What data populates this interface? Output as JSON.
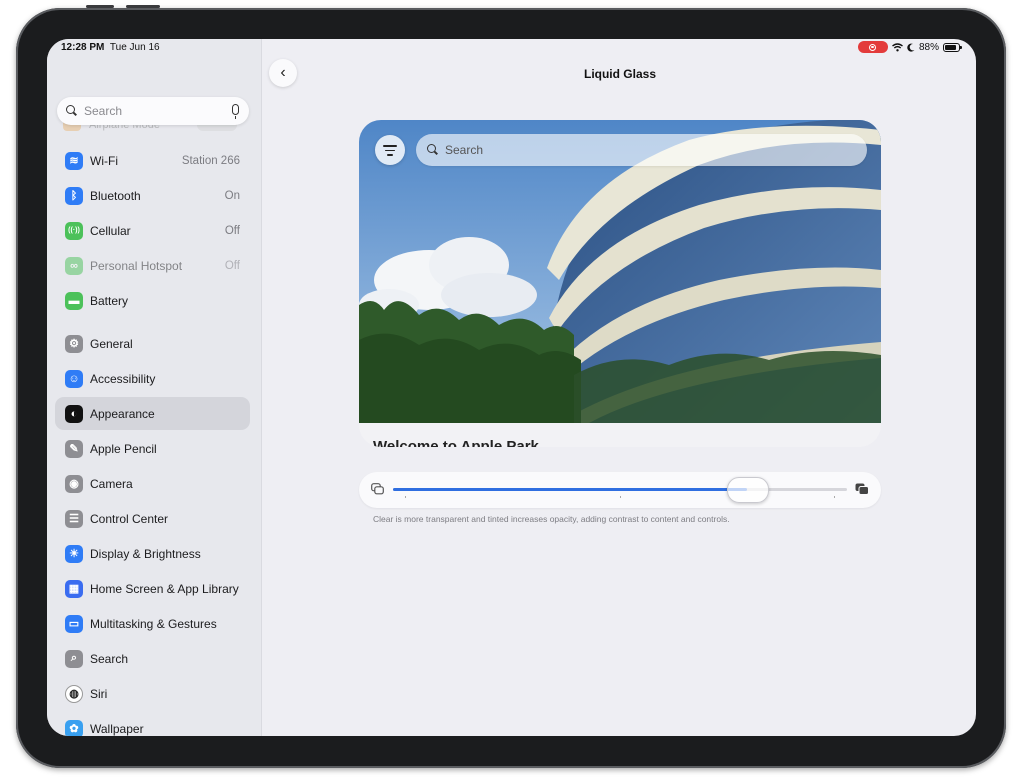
{
  "status_bar": {
    "time": "12:28 PM",
    "date": "Tue Jun 16",
    "battery": "88%",
    "battery_level": 0.88
  },
  "sidebar": {
    "search": {
      "placeholder": "Search"
    },
    "partial_item": {
      "label": "Airplane Mode"
    },
    "items": [
      {
        "label": "Wi-Fi",
        "value": "Station 266",
        "icon": "wifi-icon",
        "color": "#2f7cf6",
        "glyph": "≋"
      },
      {
        "label": "Bluetooth",
        "value": "On",
        "icon": "bluetooth-icon",
        "color": "#2f7cf6",
        "glyph": "ᛒ"
      },
      {
        "label": "Cellular",
        "value": "Off",
        "icon": "cellular-icon",
        "color": "#4cc15a",
        "glyph": "((·))"
      },
      {
        "label": "Personal Hotspot",
        "value": "Off",
        "icon": "hotspot-icon",
        "color": "#4cc15a",
        "glyph": "∞",
        "disabled": true
      },
      {
        "label": "Battery",
        "value": "",
        "icon": "battery-icon",
        "color": "#4cc15a",
        "glyph": "▬"
      },
      {
        "label": "General",
        "value": "",
        "icon": "gear-icon",
        "color": "#8e8e93",
        "glyph": "⚙"
      },
      {
        "label": "Accessibility",
        "value": "",
        "icon": "accessibility-icon",
        "color": "#2f7cf6",
        "glyph": "☺"
      },
      {
        "label": "Appearance",
        "value": "",
        "icon": "appearance-icon",
        "color": "#111111",
        "glyph": "◐",
        "selected": true
      },
      {
        "label": "Apple Pencil",
        "value": "",
        "icon": "pencil-icon",
        "color": "#8e8e93",
        "glyph": "✎"
      },
      {
        "label": "Camera",
        "value": "",
        "icon": "camera-icon",
        "color": "#8e8e93",
        "glyph": "◉"
      },
      {
        "label": "Control Center",
        "value": "",
        "icon": "control-center-icon",
        "color": "#8e8e93",
        "glyph": "☰"
      },
      {
        "label": "Display & Brightness",
        "value": "",
        "icon": "brightness-icon",
        "color": "#2f7cf6",
        "glyph": "☀"
      },
      {
        "label": "Home Screen & App Library",
        "value": "",
        "icon": "home-screen-icon",
        "color": "#3a6cf0",
        "glyph": "▦"
      },
      {
        "label": "Multitasking & Gestures",
        "value": "",
        "icon": "multitasking-icon",
        "color": "#2f7cf6",
        "glyph": "▭"
      },
      {
        "label": "Search",
        "value": "",
        "icon": "search-icon",
        "color": "#8e8e93",
        "glyph": "⌕"
      },
      {
        "label": "Siri",
        "value": "",
        "icon": "siri-icon",
        "color": "#ffffff",
        "glyph": "◍"
      },
      {
        "label": "Wallpaper",
        "value": "",
        "icon": "wallpaper-icon",
        "color": "#39a0f0",
        "glyph": "✿"
      }
    ]
  },
  "content": {
    "back_label": "‹",
    "title": "Liquid Glass",
    "preview": {
      "search_text": "Search",
      "caption": "Welcome to Apple Park"
    },
    "slider": {
      "value": 0.78
    },
    "footnote": "Clear is more transparent and tinted increases opacity, adding contrast to content and controls."
  }
}
